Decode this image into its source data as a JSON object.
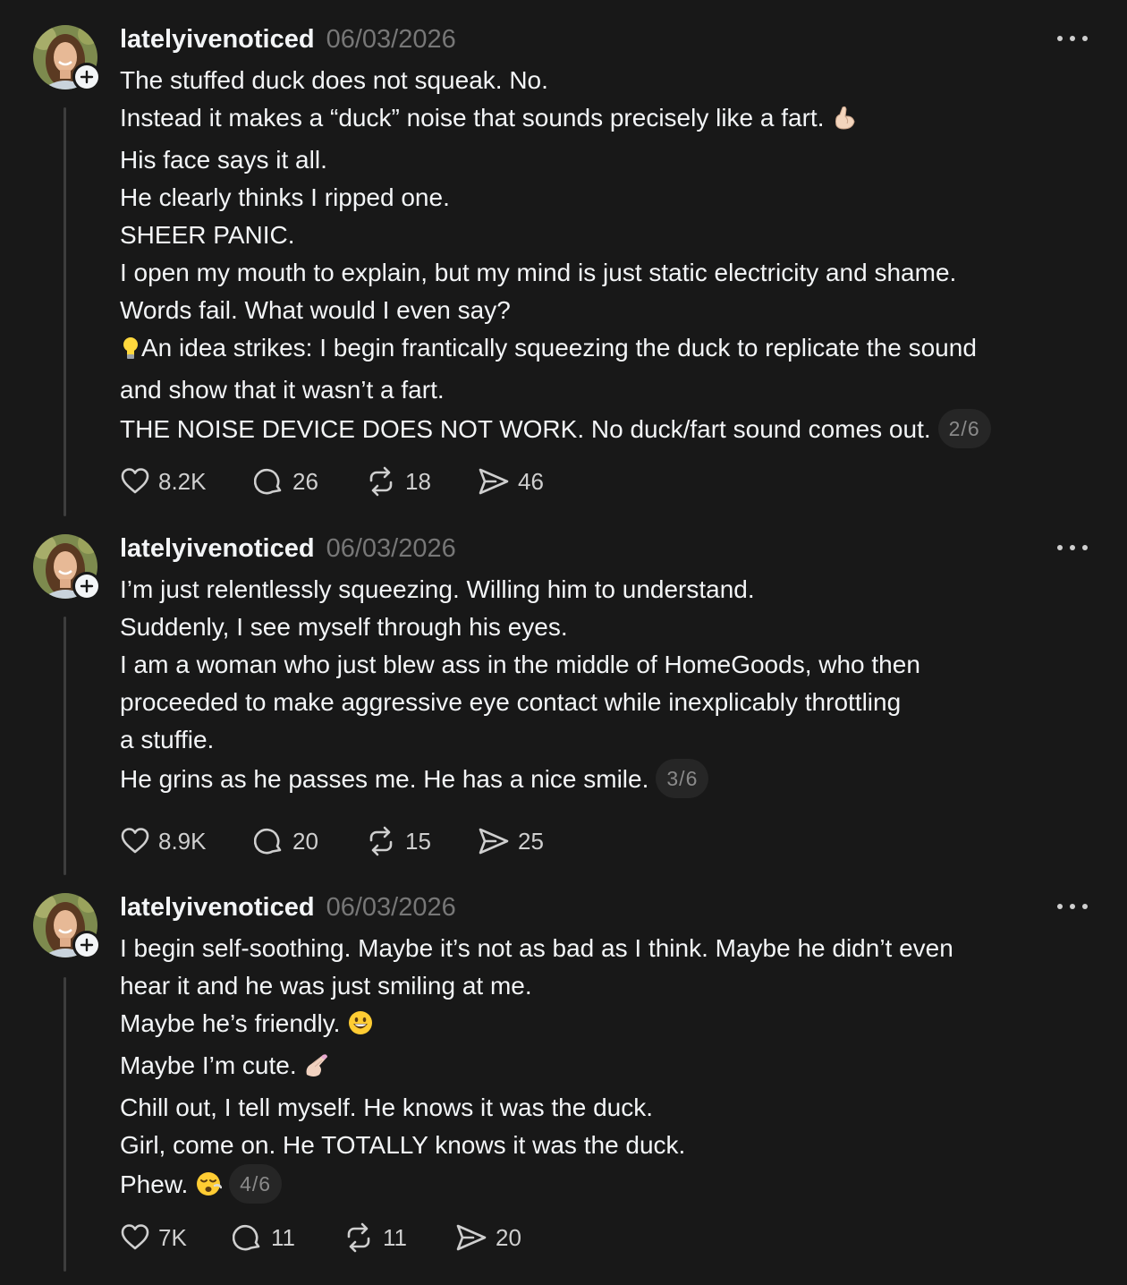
{
  "colors": {
    "background": "#181818",
    "text": "#f3f5f7",
    "muted": "#777777",
    "thread_line": "#3d3d3d",
    "pill_background": "#262626"
  },
  "posts": [
    {
      "username": "latelyivenoticed",
      "date": "06/03/2026",
      "lines": [
        "The stuffed duck does not squeak. No.",
        "Instead it makes a “duck” noise that sounds precisely like a fart.",
        "His face says it all.",
        "He clearly thinks I ripped one.",
        "SHEER PANIC.",
        "I open my mouth to explain, but my mind is just static electricity and shame.",
        "Words fail. What would I even say?",
        "An idea strikes: I begin frantically squeezing the duck to replicate the sound",
        "and show that it wasn’t a fart.",
        "THE NOISE DEVICE DOES NOT WORK. No duck/fart sound comes out."
      ],
      "page_indicator": "2/6",
      "likes": "8.2K",
      "replies": "26",
      "reposts": "18",
      "shares": "46"
    },
    {
      "username": "latelyivenoticed",
      "date": "06/03/2026",
      "lines": [
        "I’m just relentlessly squeezing. Willing him to understand.",
        "Suddenly, I see myself through his eyes.",
        "I am a woman who just blew ass in the middle of HomeGoods, who then",
        "proceeded to make aggressive eye contact while inexplicably throttling",
        "a stuffie.",
        "He grins as he passes me. He has a nice smile."
      ],
      "page_indicator": "3/6",
      "likes": "8.9K",
      "replies": "20",
      "reposts": "15",
      "shares": "25"
    },
    {
      "username": "latelyivenoticed",
      "date": "06/03/2026",
      "lines": [
        "I begin self-soothing. Maybe it’s not as bad as I think. Maybe he didn’t even",
        "hear it and he was just smiling at me.",
        "Maybe he’s friendly.",
        "Maybe I’m cute.",
        "Chill out, I tell myself. He knows it was the duck.",
        "Girl, come on. He TOTALLY knows it was the duck.",
        "Phew."
      ],
      "page_indicator": "4/6",
      "likes": "7K",
      "replies": "11",
      "reposts": "11",
      "shares": "20"
    }
  ]
}
